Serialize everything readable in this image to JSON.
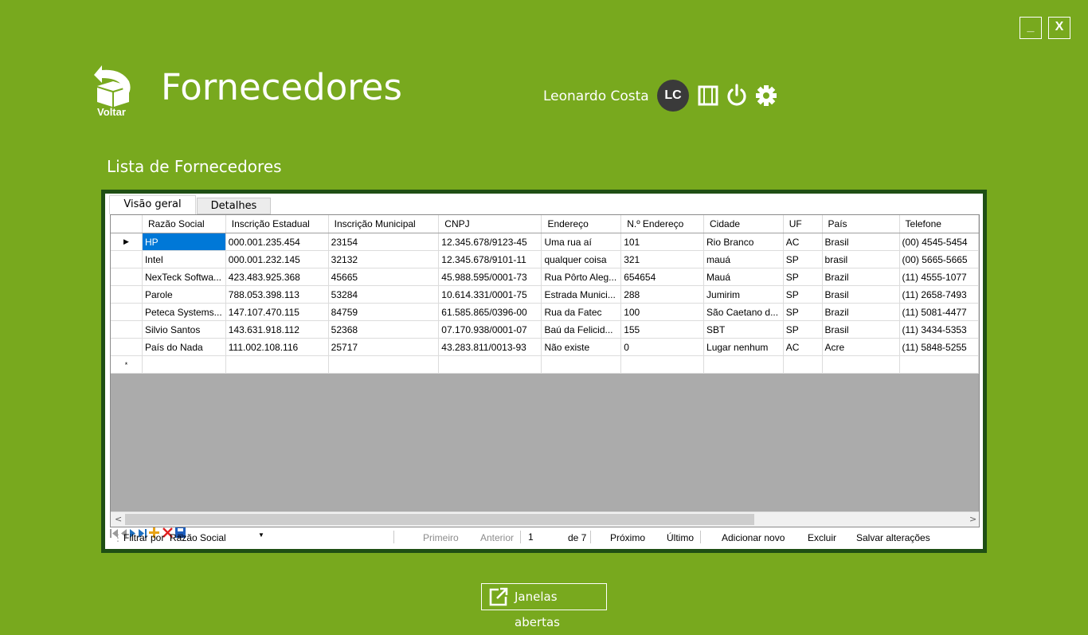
{
  "window": {
    "minimize_label": "_",
    "close_label": "X"
  },
  "header": {
    "back_label": "Voltar",
    "title": "Fornecedores",
    "user_name": "Leonardo Costa",
    "avatar_initials": "LC"
  },
  "icons": [
    "back-arrow-icon",
    "window-frame-icon",
    "power-icon",
    "gear-icon",
    "external-window-icon"
  ],
  "section": {
    "subtitle": "Lista de Fornecedores"
  },
  "tabs": [
    {
      "label": "Visão geral",
      "active": true
    },
    {
      "label": "Detalhes",
      "active": false
    }
  ],
  "grid": {
    "columns": [
      "Razão Social",
      "Inscrição Estadual",
      "Inscrição Municipal",
      "CNPJ",
      "Endereço",
      "N.º Endereço",
      "Cidade",
      "UF",
      "País",
      "Telefone"
    ],
    "rows": [
      [
        "HP",
        "000.001.235.454",
        "23154",
        "12.345.678/9123-45",
        "Uma rua aí",
        "101",
        "Rio Branco",
        "AC",
        "Brasil",
        "(00) 4545-5454"
      ],
      [
        "Intel",
        "000.001.232.145",
        "32132",
        "12.345.678/9101-11",
        "qualquer coisa",
        "321",
        "mauá",
        "SP",
        "brasil",
        "(00) 5665-5665"
      ],
      [
        "NexTeck Softwa...",
        "423.483.925.368",
        "45665",
        "45.988.595/0001-73",
        "Rua Pôrto Aleg...",
        "654654",
        "Mauá",
        "SP",
        "Brazil",
        "(11) 4555-1077"
      ],
      [
        "Parole",
        "788.053.398.113",
        "53284",
        "10.614.331/0001-75",
        "Estrada Munici...",
        "288",
        "Jumirim",
        "SP",
        "Brasil",
        "(11) 2658-7493"
      ],
      [
        "Peteca Systems...",
        "147.107.470.115",
        "84759",
        "61.585.865/0396-00",
        "Rua da Fatec",
        "100",
        "São Caetano d...",
        "SP",
        "Brazil",
        "(11) 5081-4477"
      ],
      [
        "Silvio Santos",
        "143.631.918.112",
        "52368",
        "07.170.938/0001-07",
        "Baú da Felicid...",
        "155",
        "SBT",
        "SP",
        "Brasil",
        "(11) 3434-5353"
      ],
      [
        "País do Nada",
        "111.002.108.116",
        "25717",
        "43.283.811/0013-93",
        "Não existe",
        "0",
        "Lugar nenhum",
        "AC",
        "Acre",
        "(11) 5848-5255"
      ]
    ],
    "current_row_marker": "▶",
    "new_row_marker": "*"
  },
  "navigator": {
    "filter_label": "Filtrar por",
    "filter_value": "Razão Social",
    "first_label": "Primeiro",
    "prev_label": "Anterior",
    "position": "1",
    "of_total": "de 7",
    "next_label": "Próximo",
    "last_label": "Último",
    "add_label": "Adicionar novo",
    "delete_label": "Excluir",
    "save_label": "Salvar alterações"
  },
  "footer": {
    "open_windows_label": "Janelas abertas"
  },
  "colors": {
    "background": "#78a91e",
    "panel_border": "#1f4f14",
    "selection": "#0078d7"
  }
}
